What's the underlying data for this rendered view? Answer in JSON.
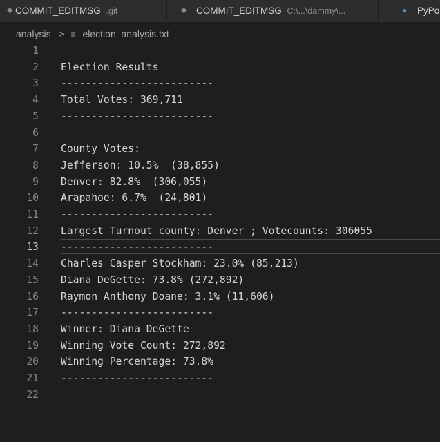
{
  "tabs": [
    {
      "icon": "git-diamond-icon",
      "label": "COMMIT_EDITMSG",
      "description": ".git"
    },
    {
      "icon": "git-diamond-icon",
      "label": "COMMIT_EDITMSG",
      "description": "C:\\...\\dammy\\..."
    },
    {
      "icon": "python-icon",
      "label": "PyPo",
      "description": ""
    }
  ],
  "breadcrumb": {
    "folder": "analysis",
    "separator": ">",
    "file": "election_analysis.txt"
  },
  "editor": {
    "active_line": 13,
    "lines": [
      {
        "n": "1",
        "text": ""
      },
      {
        "n": "2",
        "text": "Election Results"
      },
      {
        "n": "3",
        "text": "-------------------------"
      },
      {
        "n": "4",
        "text": "Total Votes: 369,711"
      },
      {
        "n": "5",
        "text": "-------------------------"
      },
      {
        "n": "6",
        "text": ""
      },
      {
        "n": "7",
        "text": "County Votes:"
      },
      {
        "n": "8",
        "text": "Jefferson: 10.5%  (38,855)"
      },
      {
        "n": "9",
        "text": "Denver: 82.8%  (306,055)"
      },
      {
        "n": "10",
        "text": "Arapahoe: 6.7%  (24,801)"
      },
      {
        "n": "11",
        "text": "-------------------------"
      },
      {
        "n": "12",
        "text": "Largest Turnout county: Denver ; Votecounts: 306055"
      },
      {
        "n": "13",
        "text": "-------------------------"
      },
      {
        "n": "14",
        "text": "Charles Casper Stockham: 23.0% (85,213)"
      },
      {
        "n": "15",
        "text": "Diana DeGette: 73.8% (272,892)"
      },
      {
        "n": "16",
        "text": "Raymon Anthony Doane: 3.1% (11,606)"
      },
      {
        "n": "17",
        "text": "-------------------------"
      },
      {
        "n": "18",
        "text": "Winner: Diana DeGette"
      },
      {
        "n": "19",
        "text": "Winning Vote Count: 272,892"
      },
      {
        "n": "20",
        "text": "Winning Percentage: 73.8%"
      },
      {
        "n": "21",
        "text": "-------------------------"
      },
      {
        "n": "22",
        "text": ""
      }
    ]
  }
}
